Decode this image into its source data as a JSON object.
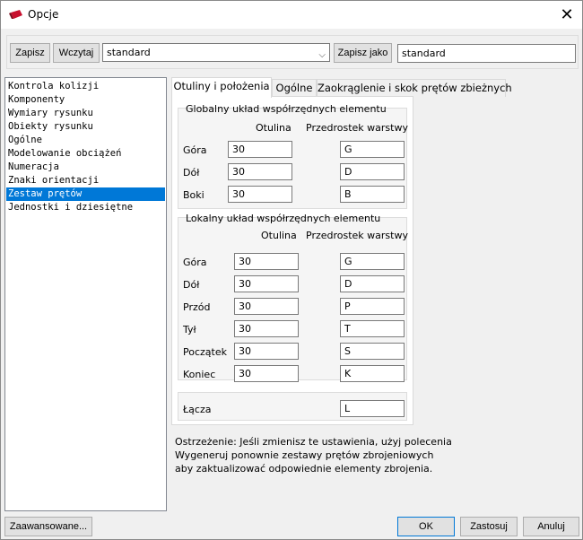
{
  "window": {
    "title": "Opcje"
  },
  "toolbar": {
    "save_label": "Zapisz",
    "load_label": "Wczytaj",
    "preset_value": "standard",
    "save_as_label": "Zapisz jako",
    "save_as_value": "standard"
  },
  "tree": {
    "items": [
      "Kontrola kolizji",
      "Komponenty",
      "Wymiary rysunku",
      "Obiekty rysunku",
      "Ogólne",
      "Modelowanie obciążeń",
      "Numeracja",
      "Znaki orientacji",
      "Zestaw prętów",
      "Jednostki i dziesiętne"
    ],
    "selected_index": 8
  },
  "tabs": [
    "Otuliny i położenia",
    "Ogólne",
    "Zaokrąglenie i skok prętów zbieżnych"
  ],
  "global_group": {
    "title": "Globalny układ współrzędnych elementu",
    "col_cover": "Otulina",
    "col_prefix": "Przedrostek warstwy",
    "rows": [
      {
        "label": "Góra",
        "cover": "30",
        "prefix": "G"
      },
      {
        "label": "Dół",
        "cover": "30",
        "prefix": "D"
      },
      {
        "label": "Boki",
        "cover": "30",
        "prefix": "B"
      }
    ]
  },
  "local_group": {
    "title": "Lokalny układ współrzędnych elementu",
    "col_cover": "Otulina",
    "col_prefix": "Przedrostek warstwy",
    "rows": [
      {
        "label": "Góra",
        "cover": "30",
        "prefix": "G"
      },
      {
        "label": "Dół",
        "cover": "30",
        "prefix": "D"
      },
      {
        "label": "Przód",
        "cover": "30",
        "prefix": "P"
      },
      {
        "label": "Tył",
        "cover": "30",
        "prefix": "T"
      },
      {
        "label": "Początek",
        "cover": "30",
        "prefix": "S"
      },
      {
        "label": "Koniec",
        "cover": "30",
        "prefix": "K"
      }
    ]
  },
  "links": {
    "label": "Łącza",
    "value": "L"
  },
  "warning": [
    "Ostrzeżenie: Jeśli zmienisz te ustawienia, użyj polecenia",
    "Wygeneruj ponownie zestawy prętów zbrojeniowych",
    "aby zaktualizować odpowiednie elementy zbrojenia."
  ],
  "footer": {
    "advanced_label": "Zaawansowane...",
    "ok_label": "OK",
    "apply_label": "Zastosuj",
    "cancel_label": "Anuluj"
  }
}
